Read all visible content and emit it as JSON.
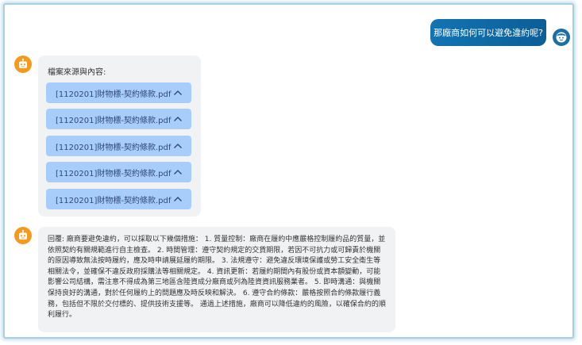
{
  "conversation": {
    "user_message": "那廠商如何可以避免違約呢?",
    "files_title": "檔案來源與內容:",
    "files": [
      {
        "name": "[1120201]財物標-契約條款.pdf"
      },
      {
        "name": "[1120201]財物標-契約條款.pdf"
      },
      {
        "name": "[1120201]財物標-契約條款.pdf"
      },
      {
        "name": "[1120201]財物標-契約條款.pdf"
      },
      {
        "name": "[1120201]財物標-契約條款.pdf"
      }
    ],
    "answer": "回覆: 廠商要避免違約，可以採取以下幾個措施： 1. 質量控制：廠商在履約中應嚴格控制履約品的質量，並依照契約有關規範進行自主檢查。 2. 時間管理：遵守契約規定的交貨期限，若因不可抗力或可歸責於機關的原因導致無法按時履約，應及時申請展延履約期限。 3. 法規遵守：避免違反環境保護或勞工安全衛生等相關法令，並確保不違反政府採購法等相關規定。 4. 資訊更新：若履約期間內有股份或資本額變動，可能影響公司結構，需注意不得成為第三地區含陸資成分廠商或列為陸資資訊服務業者。 5. 即時溝通：與機關保持良好的溝通，對於任何履約上的問題應及時反映和解決。 6. 遵守合約條款：嚴格按照合約條款履行義務，包括但不限於交付標的、提供技術支援等。 通過上述措施，廠商可以降低違約的風險，以確保合約的順利履行。"
  },
  "colors": {
    "user_bubble": "#0b6aa8",
    "bot_avatar": "#f39a1f",
    "file_button": "#a9cdfb",
    "bubble_bg": "#f1f2f4"
  }
}
